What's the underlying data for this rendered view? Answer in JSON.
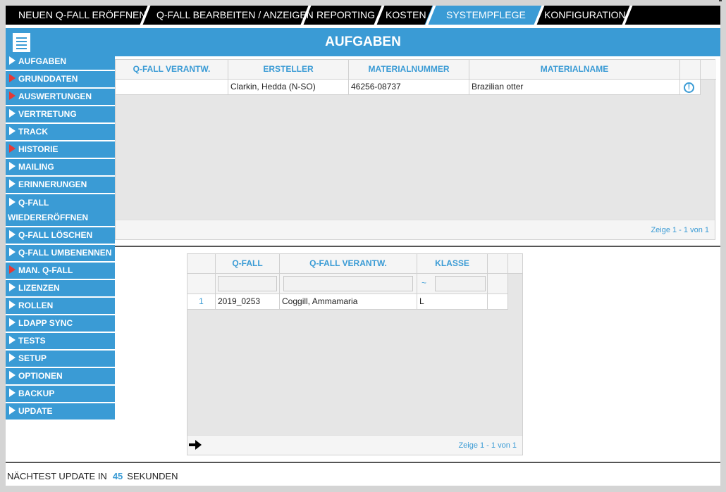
{
  "nav": {
    "tabs": [
      {
        "label": "NEUEN Q-FALL ERÖFFNEN"
      },
      {
        "label": "Q-FALL BEARBEITEN / ANZEIGEN"
      },
      {
        "label": "REPORTING"
      },
      {
        "label": "KOSTEN"
      },
      {
        "label": "SYSTEMPFLEGE",
        "active": true
      },
      {
        "label": "KONFIGURATION"
      }
    ]
  },
  "header": {
    "title": "AUFGABEN"
  },
  "sidebar": {
    "items": [
      {
        "label": "AUFGABEN",
        "marker": "white"
      },
      {
        "label": "GRUNDDATEN",
        "marker": "red"
      },
      {
        "label": "AUSWERTUNGEN",
        "marker": "red"
      },
      {
        "label": "VERTRETUNG",
        "marker": "white"
      },
      {
        "label": "TRACK",
        "marker": "white"
      },
      {
        "label": "HISTORIE",
        "marker": "red"
      },
      {
        "label": "MAILING",
        "marker": "white"
      },
      {
        "label": "ERINNERUNGEN",
        "marker": "white"
      },
      {
        "label": "Q-FALL WIEDERERÖFFNEN",
        "marker": "white"
      },
      {
        "label": "Q-FALL LÖSCHEN",
        "marker": "white"
      },
      {
        "label": "Q-FALL UMBENENNEN",
        "marker": "white"
      },
      {
        "label": "MAN. Q-FALL",
        "marker": "red"
      },
      {
        "label": "LIZENZEN",
        "marker": "white"
      },
      {
        "label": "ROLLEN",
        "marker": "white"
      },
      {
        "label": "LDAPP SYNC",
        "marker": "white"
      },
      {
        "label": "TESTS",
        "marker": "white"
      },
      {
        "label": "SETUP",
        "marker": "white"
      },
      {
        "label": "OPTIONEN",
        "marker": "white"
      },
      {
        "label": "BACKUP",
        "marker": "white"
      },
      {
        "label": "UPDATE",
        "marker": "white"
      }
    ]
  },
  "grid1": {
    "columns": [
      "Q-FALL VERANTW.",
      "ERSTELLER",
      "MATERIALNUMMER",
      "MATERIALNAME"
    ],
    "rows": [
      {
        "verantw": "",
        "ersteller": "Clarkin, Hedda (N-SO)",
        "materialnummer": "46256-08737",
        "materialname": "Brazilian otter",
        "icon": "exclamation-circle-icon"
      }
    ],
    "pager": "Zeige 1 - 1 von 1"
  },
  "grid2": {
    "columns": [
      "Q-FALL",
      "Q-FALL VERANTW.",
      "KLASSE"
    ],
    "filter_tilde": "~",
    "rows": [
      {
        "num": "1",
        "qfall": "2019_0253",
        "verantw": "Coggill, Ammamaria",
        "klasse": "L"
      }
    ],
    "pager": "Zeige 1 - 1 von 1"
  },
  "status": {
    "prefix": "NÄCHTEST UPDATE IN",
    "seconds": "45",
    "suffix": "SEKUNDEN"
  },
  "colors": {
    "accent": "#3a9bd5",
    "nav_bg": "#000000",
    "marker_red": "#e53935"
  }
}
